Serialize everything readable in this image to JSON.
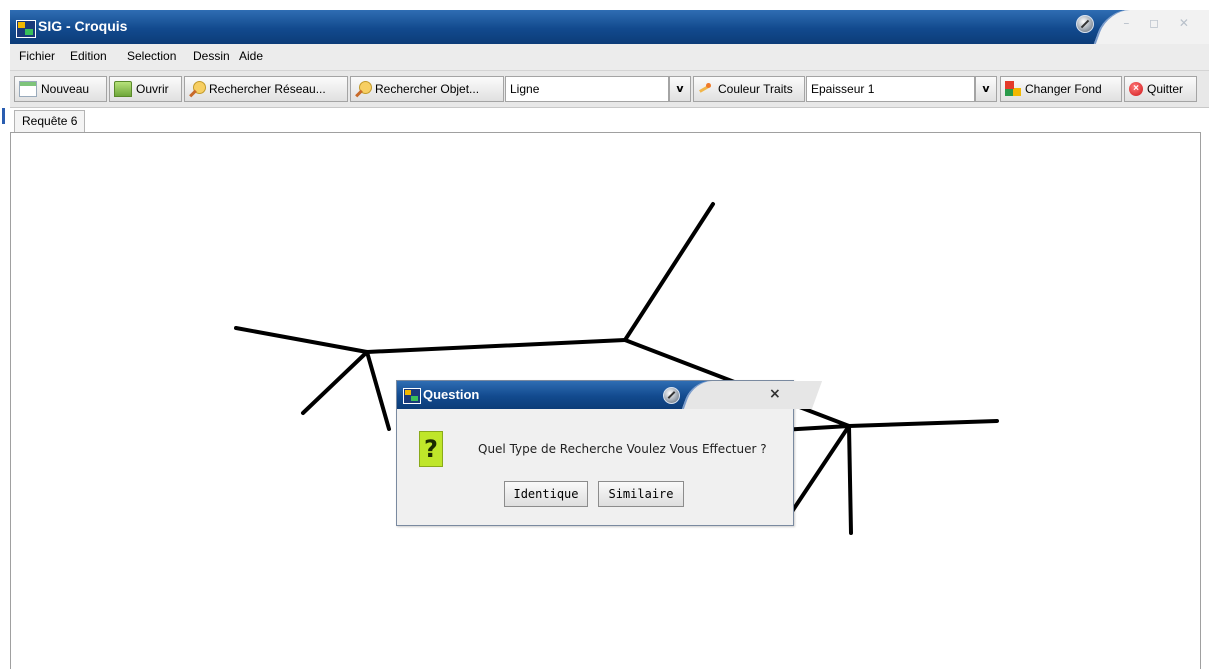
{
  "window": {
    "title": "SIG - Croquis",
    "controls": "– ◻ ✕"
  },
  "menu": {
    "items": [
      "Fichier",
      "Edition",
      "Selection",
      "Dessin",
      "Aide"
    ]
  },
  "toolbar": {
    "nouveau": "Nouveau",
    "ouvrir": "Ouvrir",
    "rechercher_reseau": "Rechercher Réseau...",
    "rechercher_objet": "Rechercher Objet...",
    "type_select": "Ligne",
    "couleur_traits": "Couleur Traits",
    "epaisseur_select": "Epaisseur 1",
    "changer_fond": "Changer Fond",
    "quitter": "Quitter",
    "dropdown_arrow": "v"
  },
  "tab": {
    "label": "Requête 6"
  },
  "dialog": {
    "title": "Question",
    "close": "×",
    "question_icon": "?",
    "message": "Quel Type de Recherche Voulez Vous Effectuer ?",
    "buttons": {
      "identique": "Identique",
      "similaire": "Similaire"
    }
  },
  "colors": {
    "titlebar": "#124a8e",
    "question_icon": "#bfe62a",
    "sketch_stroke": "#000000"
  },
  "icons": {
    "app": "app-logo-icon",
    "nouveau": "new-document-icon",
    "ouvrir": "open-folder-icon",
    "rechercher": "search-icon",
    "couleur": "color-icon",
    "fond": "background-icon",
    "quitter": "quit-icon",
    "question": "question-icon"
  }
}
